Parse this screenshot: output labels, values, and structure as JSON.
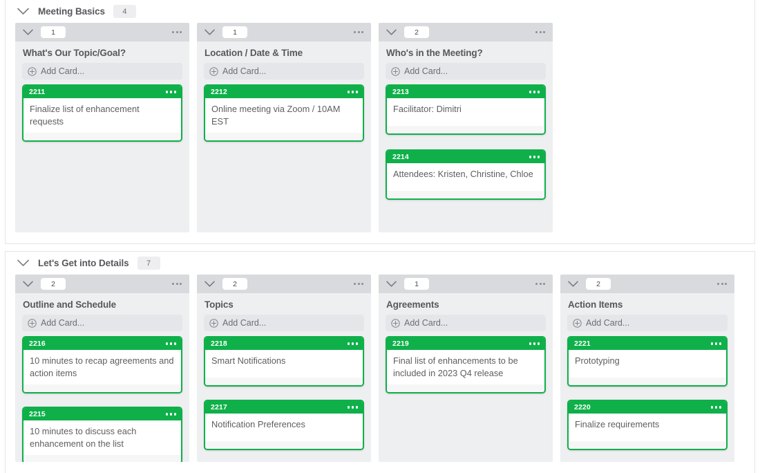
{
  "board": {
    "accent_green": "#0fb04a",
    "column_header_bg": "#d9dadd",
    "column_bg": "#eeeff1",
    "page_bg": "#ffffff"
  },
  "icons": {
    "chevron_down": "chevron-down-icon",
    "plus_circle": "plus-circle-icon",
    "more": "more-options-icon"
  },
  "swimlanes": [
    {
      "title": "Meeting Basics",
      "count": "4",
      "columns": [
        {
          "count": "1",
          "title": "What's Our Topic/Goal?",
          "add_card_label": "Add Card...",
          "cards": [
            {
              "id": "2211",
              "text": "Finalize list of enhancement requests"
            }
          ]
        },
        {
          "count": "1",
          "title": "Location / Date & Time",
          "add_card_label": "Add Card...",
          "cards": [
            {
              "id": "2212",
              "text": "Online meeting via Zoom / 10AM EST"
            }
          ]
        },
        {
          "count": "2",
          "title": "Who's in the Meeting?",
          "add_card_label": "Add Card...",
          "cards": [
            {
              "id": "2213",
              "text": "Facilitator: Dimitri"
            },
            {
              "id": "2214",
              "text": "Attendees: Kristen, Christine, Chloe"
            }
          ]
        }
      ]
    },
    {
      "title": "Let's Get into Details",
      "count": "7",
      "columns": [
        {
          "count": "2",
          "title": "Outline and Schedule",
          "add_card_label": "Add Card...",
          "cards": [
            {
              "id": "2216",
              "text": "10 minutes to recap agreements and action items"
            },
            {
              "id": "2215",
              "text": "10 minutes to discuss each enhancement on the list"
            }
          ]
        },
        {
          "count": "2",
          "title": "Topics",
          "add_card_label": "Add Card...",
          "cards": [
            {
              "id": "2218",
              "text": "Smart Notifications"
            },
            {
              "id": "2217",
              "text": "Notification Preferences"
            }
          ]
        },
        {
          "count": "1",
          "title": "Agreements",
          "add_card_label": "Add Card...",
          "cards": [
            {
              "id": "2219",
              "text": "Final list of enhancements to be included in 2023 Q4 release"
            }
          ]
        },
        {
          "count": "2",
          "title": "Action Items",
          "add_card_label": "Add Card...",
          "cards": [
            {
              "id": "2221",
              "text": "Prototyping"
            },
            {
              "id": "2220",
              "text": "Finalize requirements"
            }
          ]
        }
      ]
    }
  ]
}
